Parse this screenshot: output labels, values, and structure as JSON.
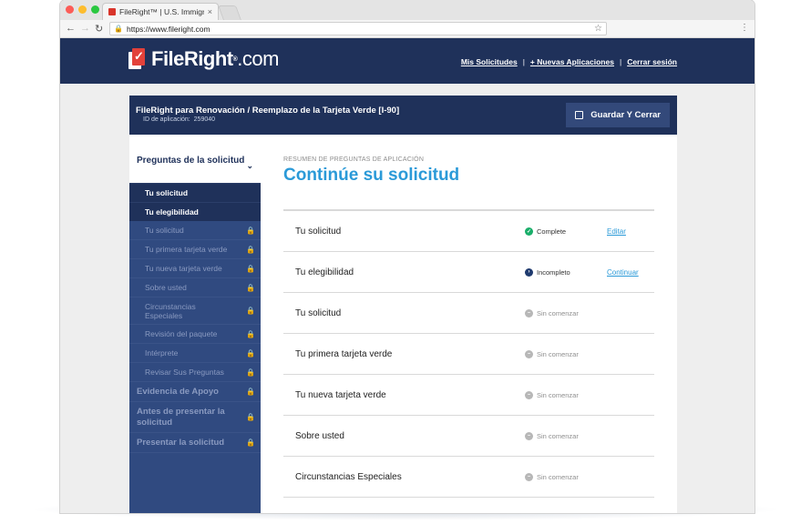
{
  "browser": {
    "tab_title": "FileRight™ | U.S. Immigration",
    "tab_close": "×",
    "url": "https://www.fileright.com"
  },
  "header": {
    "logo_text": "FileRight",
    "logo_domain": ".com",
    "logo_reg": "®",
    "nav": [
      {
        "label": "Mis Solicitudes"
      },
      {
        "label": "+ Nuevas Aplicaciones"
      },
      {
        "label": "Cerrar sesión"
      }
    ],
    "separator": "|"
  },
  "app": {
    "title": "FileRight para Renovación / Reemplazo de la Tarjeta Verde [I-90]",
    "id_label": "ID de aplicación:",
    "id_value": "259040",
    "save_label": "Guardar Y Cerrar"
  },
  "sidebar": {
    "section_active": "Preguntas de la solicitud",
    "sub_active": [
      "Tu solicitud",
      "Tu elegibilidad"
    ],
    "items_locked": [
      "Tu solicitud",
      "Tu primera tarjeta verde",
      "Tu nueva tarjeta verde",
      "Sobre usted",
      "Circunstancias Especiales",
      "Revisión del paquete",
      "Intérprete",
      "Revisar Sus Preguntas"
    ],
    "sections_locked": [
      "Evidencia de Apoyo",
      "Antes de presentar la solicitud",
      "Presentar la solicitud"
    ]
  },
  "main": {
    "eyebrow": "RESUMEN DE PREGUNTAS DE APLICACIÓN",
    "heading": "Continúe su solicitud",
    "rows": [
      {
        "label": "Tu solicitud",
        "status": "Complete",
        "action": "Editar"
      },
      {
        "label": "Tu elegibilidad",
        "status": "Incompleto",
        "action": "Continuar"
      },
      {
        "label": "Tu solicitud",
        "status": "Sin comenzar",
        "action": ""
      },
      {
        "label": "Tu primera tarjeta verde",
        "status": "Sin comenzar",
        "action": ""
      },
      {
        "label": "Tu nueva tarjeta verde",
        "status": "Sin comenzar",
        "action": ""
      },
      {
        "label": "Sobre usted",
        "status": "Sin comenzar",
        "action": ""
      },
      {
        "label": "Circunstancias Especiales",
        "status": "Sin comenzar",
        "action": ""
      }
    ]
  },
  "colors": {
    "navy": "#1f315a",
    "sidebar": "#304a80",
    "accent": "#2b9ad8",
    "complete": "#1aae6a"
  }
}
